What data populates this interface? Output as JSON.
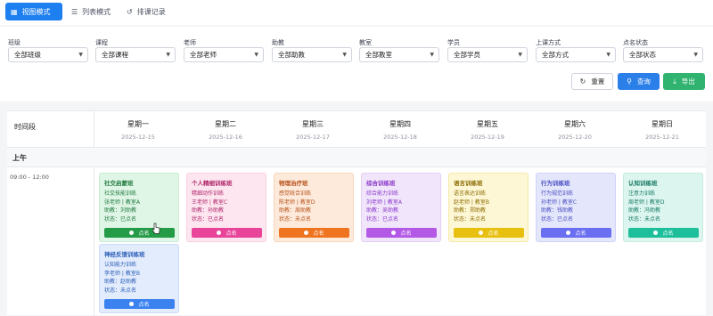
{
  "tabs": {
    "grid": "视图模式",
    "list": "列表模式",
    "history": "排课记录"
  },
  "filters": [
    {
      "label": "班级",
      "value": "全部班级"
    },
    {
      "label": "课程",
      "value": "全部课程"
    },
    {
      "label": "老师",
      "value": "全部老师"
    },
    {
      "label": "助教",
      "value": "全部助教"
    },
    {
      "label": "教室",
      "value": "全部教室"
    },
    {
      "label": "学员",
      "value": "全部学员"
    },
    {
      "label": "上课方式",
      "value": "全部方式"
    },
    {
      "label": "点名状态",
      "value": "全部状态"
    }
  ],
  "actions": {
    "reset": "重置",
    "query": "查询",
    "export": "导出"
  },
  "schedule": {
    "time_header": "时间段",
    "days": [
      {
        "name": "星期一",
        "date": "2025-12-15"
      },
      {
        "name": "星期二",
        "date": "2025-12-16"
      },
      {
        "name": "星期三",
        "date": "2025-12-17"
      },
      {
        "name": "星期四",
        "date": "2025-12-18"
      },
      {
        "name": "星期五",
        "date": "2025-12-19"
      },
      {
        "name": "星期六",
        "date": "2025-12-20"
      },
      {
        "name": "星期日",
        "date": "2025-12-21"
      }
    ],
    "period": "上午",
    "slot": "09:00 - 12:00",
    "cards": [
      {
        "title": "社交启蒙班",
        "course": "社交技能训练",
        "teacher": "张老师 | 教室A",
        "assistant": "助教：刘助教",
        "status": "状态：已点名",
        "button": "点名",
        "color": "green"
      },
      {
        "title": "个人精细训练班",
        "course": "精细动作训练",
        "teacher": "王老师 | 教室C",
        "assistant": "助教：孙助教",
        "status": "状态：已点名",
        "button": "点名",
        "color": "pink"
      },
      {
        "title": "物理治疗班",
        "course": "感觉统合训练",
        "teacher": "陈老师 | 教室D",
        "assistant": "助教：周助教",
        "status": "状态：未点名",
        "button": "点名",
        "color": "orange"
      },
      {
        "title": "综合训练班",
        "course": "综合能力训练",
        "teacher": "刘老师 | 教室A",
        "assistant": "助教：吴助教",
        "status": "状态：已点名",
        "button": "点名",
        "color": "purple"
      },
      {
        "title": "语言训练班",
        "course": "语言表达训练",
        "teacher": "赵老师 | 教室B",
        "assistant": "助教：郑助教",
        "status": "状态：未点名",
        "button": "点名",
        "color": "yellow"
      },
      {
        "title": "行为训练班",
        "course": "行为规范训练",
        "teacher": "孙老师 | 教室C",
        "assistant": "助教：钱助教",
        "status": "状态：已点名",
        "button": "点名",
        "color": "indigo"
      },
      {
        "title": "认知训练班",
        "course": "注意力训练",
        "teacher": "周老师 | 教室D",
        "assistant": "助教：冯助教",
        "status": "状态：未点名",
        "button": "点名",
        "color": "teal"
      },
      {
        "title": "神经反馈训练班",
        "course": "认知能力训练",
        "teacher": "李老师 | 教室B",
        "assistant": "助教：赵助教",
        "status": "状态：未点名",
        "button": "点名",
        "color": "blue"
      }
    ]
  }
}
